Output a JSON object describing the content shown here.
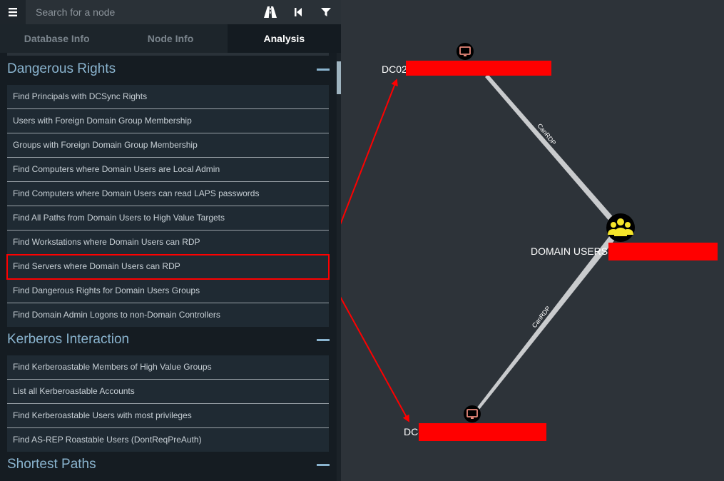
{
  "search": {
    "placeholder": "Search for a node"
  },
  "icons": {
    "menu": "hamburger-menu-icon",
    "pathfinding": "road-icon",
    "back": "step-back-icon",
    "filter": "filter-icon",
    "computer": "monitor-icon",
    "group": "users-group-icon"
  },
  "tabs": [
    {
      "label": "Database Info"
    },
    {
      "label": "Node Info"
    },
    {
      "label": "Analysis",
      "active": true
    }
  ],
  "sections": [
    {
      "title": "Dangerous Rights",
      "items": [
        "Find Principals with DCSync Rights",
        "Users with Foreign Domain Group Membership",
        "Groups with Foreign Domain Group Membership",
        "Find Computers where Domain Users are Local Admin",
        "Find Computers where Domain Users can read LAPS passwords",
        "Find All Paths from Domain Users to High Value Targets",
        "Find Workstations where Domain Users can RDP",
        "Find Servers where Domain Users can RDP",
        "Find Dangerous Rights for Domain Users Groups",
        "Find Domain Admin Logons to non-Domain Controllers"
      ],
      "selected_index": 7
    },
    {
      "title": "Kerberos Interaction",
      "items": [
        "Find Kerberoastable Members of High Value Groups",
        "List all Kerberoastable Accounts",
        "Find Kerberoastable Users with most privileges",
        "Find AS-REP Roastable Users (DontReqPreAuth)"
      ]
    },
    {
      "title": "Shortest Paths",
      "items": []
    }
  ],
  "graph": {
    "nodes": {
      "dc02": {
        "label": "DC02",
        "type": "computer"
      },
      "domain_users": {
        "label": "DOMAIN USERS@",
        "type": "group"
      },
      "dc": {
        "label": "DC-",
        "type": "computer"
      }
    },
    "edges": [
      {
        "from": "dc02",
        "to": "domain_users",
        "label": "CanRDP"
      },
      {
        "from": "dc",
        "to": "domain_users",
        "label": "CanRDP"
      }
    ]
  },
  "colors": {
    "panel_bg": "#151c22",
    "graph_bg": "#2d3339",
    "section_title": "#8ab4cf",
    "highlight": "#ff0000",
    "group_node": "#f5e52a",
    "computer_icon": "#e8887a"
  }
}
